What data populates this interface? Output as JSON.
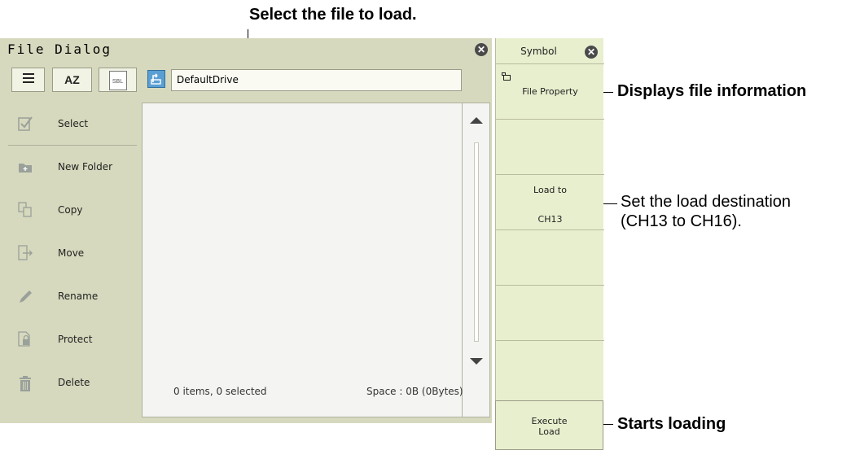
{
  "dialog": {
    "title": "File Dialog",
    "path": "DefaultDrive",
    "toolbar": {
      "sort_label": "AZ",
      "sbl_label": "SBL"
    },
    "sidebar": [
      {
        "label": "Select",
        "icon": "select-icon"
      },
      {
        "label": "New Folder",
        "icon": "new-folder-icon"
      },
      {
        "label": "Copy",
        "icon": "copy-icon"
      },
      {
        "label": "Move",
        "icon": "move-icon"
      },
      {
        "label": "Rename",
        "icon": "rename-icon"
      },
      {
        "label": "Protect",
        "icon": "protect-icon"
      },
      {
        "label": "Delete",
        "icon": "delete-icon"
      }
    ],
    "status_items": "0 items, 0 selected",
    "status_space": "Space : 0B (0Bytes)"
  },
  "panel": {
    "title": "Symbol",
    "file_property": "File Property",
    "load_to_label": "Load to",
    "load_to_value": "CH13",
    "execute_line1": "Execute",
    "execute_line2": "Load"
  },
  "callouts": {
    "top": "Select the file to load.",
    "file_info": "Displays file information",
    "load_dest_1": "Set the load destination",
    "load_dest_2": "(CH13 to CH16).",
    "starts_loading": "Starts loading"
  },
  "colors": {
    "dialog_bg": "#d6d9bd",
    "panel_bg": "#e8efce",
    "list_bg": "#f4f5f2"
  }
}
